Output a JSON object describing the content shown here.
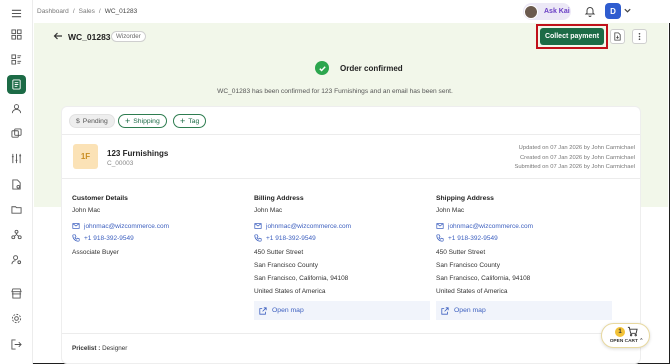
{
  "breadcrumb": {
    "items": [
      "Dashboard",
      "Sales",
      "WC_01283"
    ],
    "separator": "/"
  },
  "topbar": {
    "ask_kai": "Ask Kai",
    "user_initial": "D"
  },
  "header": {
    "order_id": "WC_01283",
    "tag": "Wizorder",
    "collect_payment": "Collect payment"
  },
  "confirmation": {
    "title": "Order confirmed",
    "message": "WC_01283 has been confirmed for 123 Furnishings and an email has been sent."
  },
  "pills": {
    "pending": "Pending",
    "shipping": "Shipping",
    "tag": "Tag"
  },
  "customer": {
    "initials": "1F",
    "name": "123 Furnishings",
    "code": "C_00003",
    "updated": "Updated on 07 Jan 2026 by John Carmichael",
    "created": "Created on 07 Jan 2026 by John Carmichael",
    "submitted": "Submitted on 07 Jan 2026 by John Carmichael"
  },
  "customer_details": {
    "title": "Customer Details",
    "name": "John Mac",
    "email": "johnmac@wizcommerce.com",
    "phone": "+1 918-392-9549",
    "role": "Associate Buyer"
  },
  "billing": {
    "title": "Billing Address",
    "name": "John Mac",
    "email": "johnmac@wizcommerce.com",
    "phone": "+1 918-392-9549",
    "line1": "450 Sutter Street",
    "line2": "San Francisco County",
    "line3": "San Francisco, California, 94108",
    "country": "United States of America",
    "map": "Open map"
  },
  "shipping": {
    "title": "Shipping Address",
    "name": "John Mac",
    "email": "johnmac@wizcommerce.com",
    "phone": "+1 918-392-9549",
    "line1": "450 Sutter Street",
    "line2": "San Francisco County",
    "line3": "San Francisco, California, 94108",
    "country": "United States of America",
    "map": "Open map"
  },
  "pricelist": {
    "label": "Pricelist :",
    "value": "Designer"
  },
  "cart": {
    "count": "1",
    "label": "OPEN CART"
  },
  "colors": {
    "brand_green": "#1c6b46",
    "highlight_red": "#c0101a",
    "link_blue": "#3c5fbf",
    "success_green": "#2ca64e"
  },
  "icons": [
    "menu-icon",
    "dashboard-icon",
    "catalog-icon",
    "orders-icon",
    "customer-icon",
    "inventory-icon",
    "settings-sliders-icon",
    "document-icon",
    "folder-icon",
    "network-icon",
    "user-settings-icon",
    "store-icon",
    "gear-icon",
    "logout-icon"
  ]
}
